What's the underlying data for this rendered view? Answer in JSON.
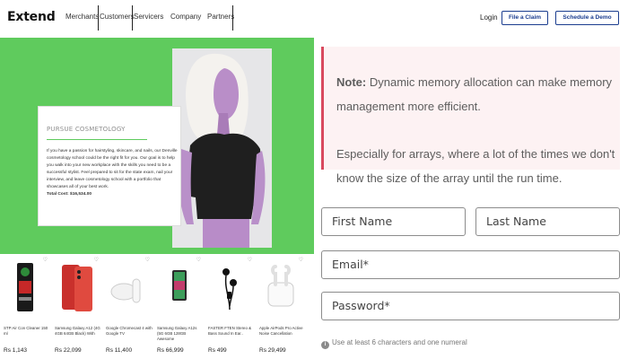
{
  "brand": {
    "logo": "Extend"
  },
  "nav": {
    "items": [
      "Merchants",
      "Customers",
      "Servicers",
      "Company",
      "Partners"
    ]
  },
  "hero": {
    "card_title": "PURSUE COSMETOLOGY",
    "card_body": "If you have a passion for hairstyling, skincare, and nails, our Denville cosmetology school could be the right fit for you. Our goal is to help you walk into your new workplace with the skills you need to be a successful stylist. Feel prepared to sit for the state exam, nail your interview, and leave cosmetology school with a portfolio that showcases all of your best work.",
    "card_cost": "Total Cost: $16,534.00"
  },
  "products": [
    {
      "name": "STP Air Con Cleaner 150 ml",
      "price": "Rs 1,143",
      "icon": "spray-can-icon"
    },
    {
      "name": "Samsung Galaxy A12 (4G 4GB 64GB Black) With",
      "price": "Rs 22,099",
      "icon": "red-phone-icon"
    },
    {
      "name": "Google Chromecast 4 with Google TV",
      "price": "Rs 11,400",
      "icon": "chromecast-icon"
    },
    {
      "name": "Samsung Galaxy A12s (5G 6GB 128GB Awesome",
      "price": "Rs 66,999",
      "icon": "samsung-phone-icon"
    },
    {
      "name": "FASTER FTEN Stereo & Bass Sound In Ear..",
      "price": "Rs 499",
      "icon": "earphones-icon"
    },
    {
      "name": "Apple AirPods Pro Active Noise Cancellation",
      "price": "Rs 29,499",
      "icon": "airpods-icon"
    }
  ],
  "header_right": {
    "login": "Login",
    "file_claim": "File a Claim",
    "schedule_demo": "Schedule a Demo"
  },
  "note": {
    "label": "Note:",
    "line1": "Dynamic memory allocation can make memory management more efficient.",
    "line2": "Especially for arrays, where a lot of the times we don't know the size of the array until the run time."
  },
  "form": {
    "first_name": "First Name",
    "last_name": "Last Name",
    "email": "Email*",
    "password": "Password*",
    "hint": "Use at least 6 characters and one numeral"
  },
  "colors": {
    "hero_green": "#5fcb5d",
    "brand_blue": "#1b3d8f",
    "note_red": "#d9495e"
  }
}
